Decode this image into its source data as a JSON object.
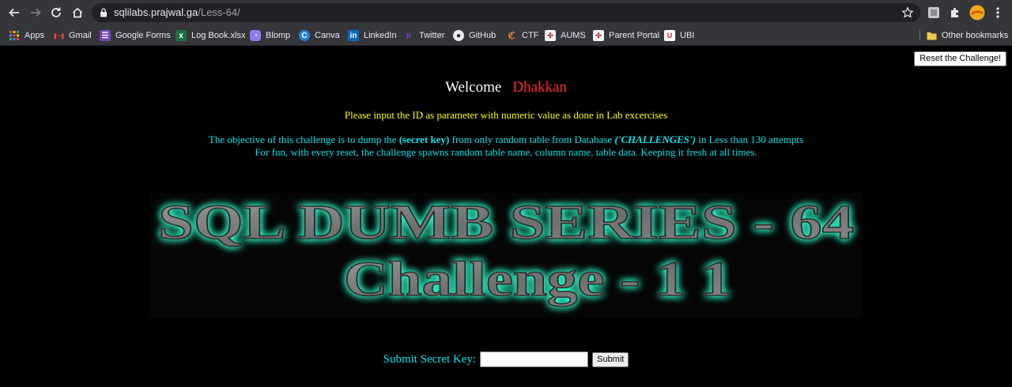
{
  "browser": {
    "url_host": "sqlilabs.prajwal.ga",
    "url_path": "/Less-64/"
  },
  "bookmarks": [
    {
      "label": "Apps",
      "icon": "apps-grid-icon",
      "color": "#e8eaed"
    },
    {
      "label": "Gmail",
      "icon": "gmail-icon",
      "color": "#ea4335"
    },
    {
      "label": "Google Forms",
      "icon": "google-forms-icon",
      "color": "#7248b9"
    },
    {
      "label": "Log Book.xlsx",
      "icon": "excel-icon",
      "color": "#1d6f42"
    },
    {
      "label": "Blomp",
      "icon": "blomp-icon",
      "color": "#8f7cf5"
    },
    {
      "label": "Canva",
      "icon": "canva-icon",
      "color": "#2b7fd8"
    },
    {
      "label": "LinkedIn",
      "icon": "linkedin-icon",
      "color": "#0a66c2"
    },
    {
      "label": "Twitter",
      "icon": "twitter-icon",
      "color": "#7a3cf2"
    },
    {
      "label": "GitHub",
      "icon": "github-icon",
      "color": "#e8eaed"
    },
    {
      "label": "CTF",
      "icon": "ctf-icon",
      "color": "#e8823a"
    },
    {
      "label": "AUMS",
      "icon": "aums-icon",
      "color": "#f3f3f3"
    },
    {
      "label": "Parent Portal",
      "icon": "parent-portal-icon",
      "color": "#f3f3f3"
    },
    {
      "label": "UBI",
      "icon": "ubi-icon",
      "color": "#d6202f"
    }
  ],
  "other_bookmarks": "Other bookmarks",
  "page": {
    "reset_button": "Reset the Challenge!",
    "welcome_text": "Welcome",
    "welcome_name": "Dhakkan",
    "instruction": "Please input the ID as parameter with numeric value as done in Lab excercises",
    "objective_pre": "The objective of this challenge is to dump the ",
    "objective_secret": "(secret key)",
    "objective_mid": " from only random table from Database ",
    "objective_db": "('CHALLENGES')",
    "objective_post": " in Less than 130 attempts",
    "objective_line2": "For fun, with every reset, the challenge spawns random table name, column name, table data. Keeping it fresh at all times.",
    "banner_line1": "SQL DUMB SERIES - 64",
    "banner_line2": "Challenge - 1 1",
    "submit_label": "Submit Secret Key:",
    "submit_value": "",
    "submit_button": "Submit"
  },
  "colors": {
    "welcome_name": "#ff2a2a",
    "instruction": "#ffff00",
    "objective": "#00e5ee",
    "banner_glow": "#30ffd0"
  }
}
